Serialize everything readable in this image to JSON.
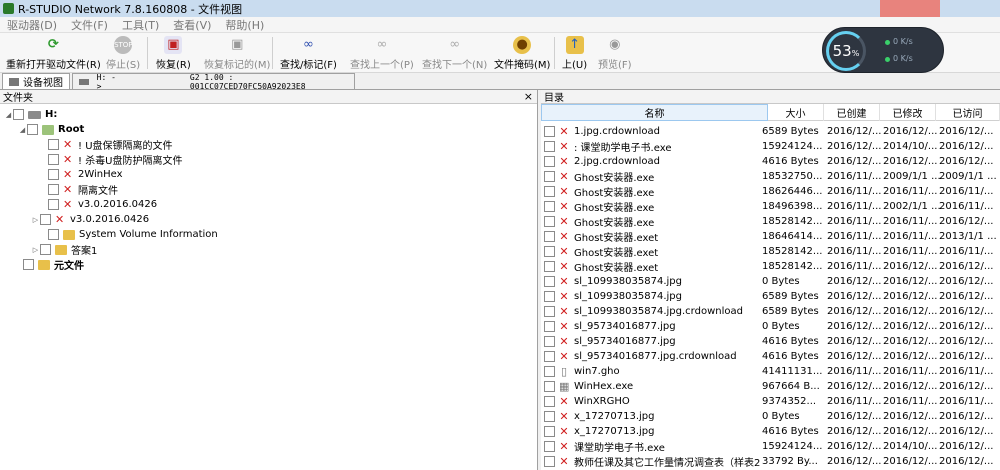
{
  "window": {
    "title": "R-STUDIO Network 7.8.160808 - 文件视图"
  },
  "menu": [
    "驱动器(D)",
    "文件(F)",
    "工具(T)",
    "查看(V)",
    "帮助(H)"
  ],
  "toolbar": {
    "reopen": "重新打开驱动文件(R)",
    "stop": "停止(S)",
    "recover": "恢复(R)",
    "recover_marked": "恢复标记的(M)",
    "find_mark": "查找/标记(F)",
    "find_prev": "查找上一个(P)",
    "find_next": "查找下一个(N)",
    "file_mask": "文件掩码(M)",
    "up": "上(U)",
    "preview": "预览(F)"
  },
  "gauge": {
    "percent": "53",
    "unit": "%",
    "up": "0 K/s",
    "down": "0 K/s"
  },
  "tabs": {
    "device_view": "设备视图",
    "drive_label": "H: ->",
    "drive_info": "G2 1.00 : 001CC07CED70FC50A92023E8"
  },
  "left_panel": {
    "title": "文件夹",
    "close": "×",
    "tree": [
      {
        "label": "H:",
        "kind": "drive"
      },
      {
        "label": "Root",
        "kind": "root"
      },
      {
        "label": "!       U盘保镖隔离的文件",
        "kind": "xfile"
      },
      {
        "label": "!       杀毒U盘防护隔离文件",
        "kind": "xfile"
      },
      {
        "label": "2WinHex",
        "kind": "xfile"
      },
      {
        "label": "      隔离文件",
        "kind": "xfile"
      },
      {
        "label": "          v3.0.2016.0426",
        "kind": "xfile"
      },
      {
        "label": "          v3.0.2016.0426",
        "kind": "xfile"
      },
      {
        "label": "System Volume Information",
        "kind": "folder"
      },
      {
        "label": "答案1",
        "kind": "folder"
      },
      {
        "label": "元文件",
        "kind": "meta"
      }
    ]
  },
  "right_panel": {
    "title": "目录",
    "columns": [
      "名称",
      "大小",
      "已创建",
      "已修改",
      "已访问"
    ],
    "rows": [
      {
        "name": "1.jpg.crdownload",
        "size": "6589 Bytes",
        "created": "2016/12/...",
        "modified": "2016/12/...",
        "accessed": "2016/12/..."
      },
      {
        "name": ":                               课堂助学电子书.exe",
        "size": "15924124...",
        "created": "2016/12/...",
        "modified": "2014/10/...",
        "accessed": "2016/12/..."
      },
      {
        "name": "2.jpg.crdownload",
        "size": "4616 Bytes",
        "created": "2016/12/...",
        "modified": "2016/12/...",
        "accessed": "2016/12/..."
      },
      {
        "name": "Ghost安装器.exe",
        "size": "18532750...",
        "created": "2016/11/...",
        "modified": "2009/1/1 ...",
        "accessed": "2009/1/1 ..."
      },
      {
        "name": "Ghost安装器.exe",
        "size": "18626446...",
        "created": "2016/11/...",
        "modified": "2016/11/...",
        "accessed": "2016/11/..."
      },
      {
        "name": "Ghost安装器.exe",
        "size": "18496398...",
        "created": "2016/11/...",
        "modified": "2002/1/1 ...",
        "accessed": "2016/11/..."
      },
      {
        "name": "Ghost安装器.exe",
        "size": "18528142...",
        "created": "2016/11/...",
        "modified": "2016/11/...",
        "accessed": "2016/12/..."
      },
      {
        "name": "Ghost安装器.exet",
        "size": "18646414...",
        "created": "2016/11/...",
        "modified": "2016/11/...",
        "accessed": "2013/1/1 ..."
      },
      {
        "name": "Ghost安装器.exet",
        "size": "18528142...",
        "created": "2016/11/...",
        "modified": "2016/11/...",
        "accessed": "2016/11/..."
      },
      {
        "name": "Ghost安装器.exet",
        "size": "18528142...",
        "created": "2016/11/...",
        "modified": "2016/12/...",
        "accessed": "2016/12/..."
      },
      {
        "name": "sl_109938035874.jpg",
        "size": "0 Bytes",
        "created": "2016/12/...",
        "modified": "2016/12/...",
        "accessed": "2016/12/..."
      },
      {
        "name": "sl_109938035874.jpg",
        "size": "6589 Bytes",
        "created": "2016/12/...",
        "modified": "2016/12/...",
        "accessed": "2016/12/..."
      },
      {
        "name": "sl_109938035874.jpg.crdownload",
        "size": "6589 Bytes",
        "created": "2016/12/...",
        "modified": "2016/12/...",
        "accessed": "2016/12/..."
      },
      {
        "name": "sl_95734016877.jpg",
        "size": "0 Bytes",
        "created": "2016/12/...",
        "modified": "2016/12/...",
        "accessed": "2016/12/..."
      },
      {
        "name": "sl_95734016877.jpg",
        "size": "4616 Bytes",
        "created": "2016/12/...",
        "modified": "2016/12/...",
        "accessed": "2016/12/..."
      },
      {
        "name": "sl_95734016877.jpg.crdownload",
        "size": "4616 Bytes",
        "created": "2016/12/...",
        "modified": "2016/12/...",
        "accessed": "2016/12/..."
      },
      {
        "name": "win7.gho",
        "size": "41411131...",
        "created": "2016/11/...",
        "modified": "2016/11/...",
        "accessed": "2016/11/..."
      },
      {
        "name": "WinHex.exe",
        "size": "967664 B...",
        "created": "2016/12/...",
        "modified": "2016/12/...",
        "accessed": "2016/12/..."
      },
      {
        "name": "WinXRGHO",
        "size": "9374352...",
        "created": "2016/11/...",
        "modified": "2016/11/...",
        "accessed": "2016/11/..."
      },
      {
        "name": "x_17270713.jpg",
        "size": "0 Bytes",
        "created": "2016/12/...",
        "modified": "2016/12/...",
        "accessed": "2016/12/..."
      },
      {
        "name": "x_17270713.jpg",
        "size": "4616 Bytes",
        "created": "2016/12/...",
        "modified": "2016/12/...",
        "accessed": "2016/12/..."
      },
      {
        "name": "                              课堂助学电子书.exe",
        "size": "15924124...",
        "created": "2016/12/...",
        "modified": "2014/10/...",
        "accessed": "2016/12/..."
      },
      {
        "name": "教师任课及其它工作量情况调查表（样表201...",
        "size": "33792 By...",
        "created": "2016/12/...",
        "modified": "2016/12/...",
        "accessed": "2016/12/..."
      }
    ]
  },
  "colors": {
    "titlebar": "#c9dcef",
    "header_sel": "#e8f2fb",
    "xmark": "#d02020",
    "folder": "#e8c04a"
  }
}
